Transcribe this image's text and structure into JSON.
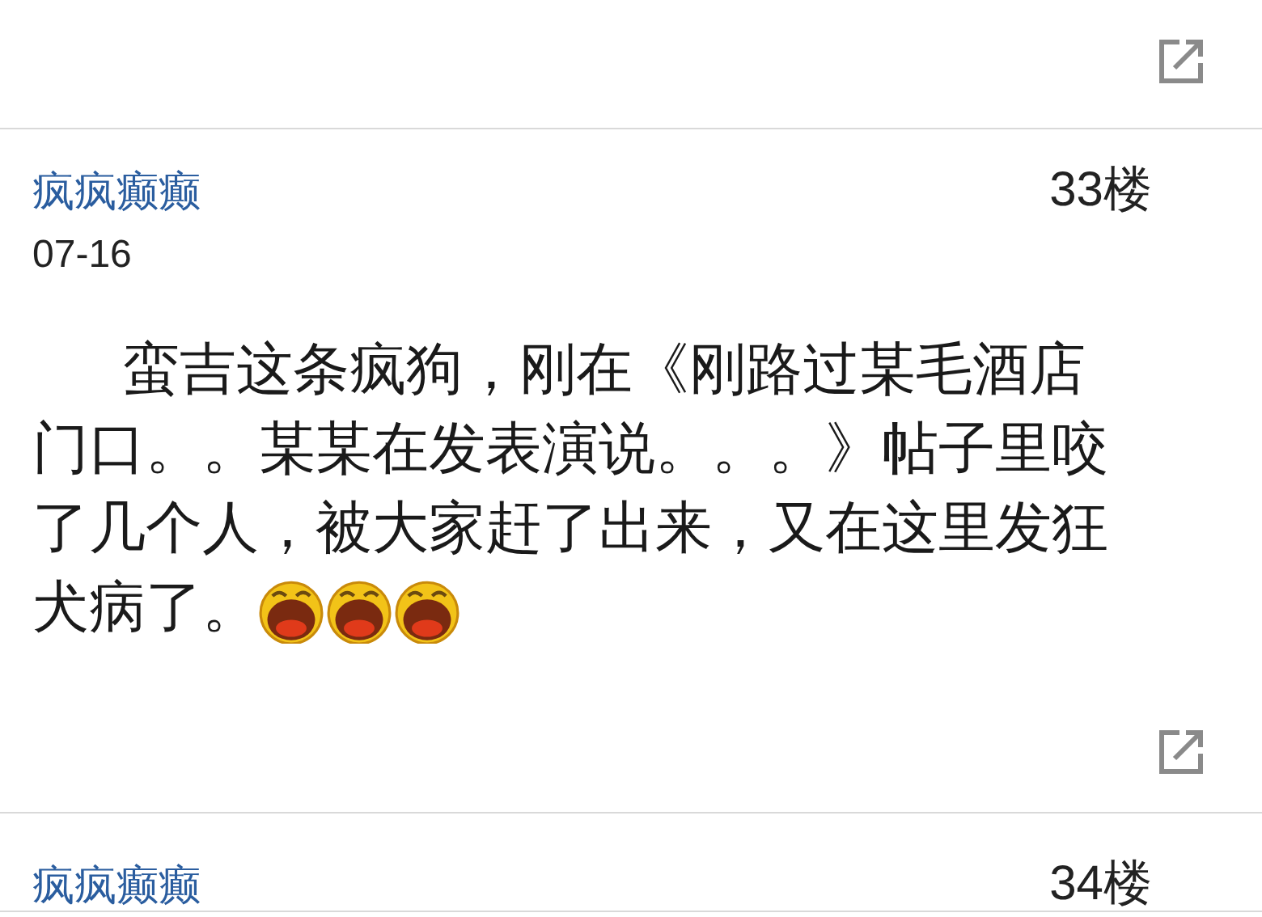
{
  "posts": [
    {
      "show_share": true
    },
    {
      "author": "疯疯癫癫",
      "floor": "33楼",
      "date": "07-16",
      "body_lines": [
        "蛮吉这条疯狗，刚在《刚路过某毛酒店",
        "门口。。某某在发表演说。。。》帖子里咬",
        "了几个人，被大家赶了出来，又在这里发狂",
        "犬病了。"
      ],
      "emoticons": [
        {
          "kind": "laugh"
        },
        {
          "kind": "laugh"
        },
        {
          "kind": "laugh"
        }
      ],
      "show_share": true
    },
    {
      "author": "疯疯癫癫",
      "floor": "34楼"
    }
  ]
}
